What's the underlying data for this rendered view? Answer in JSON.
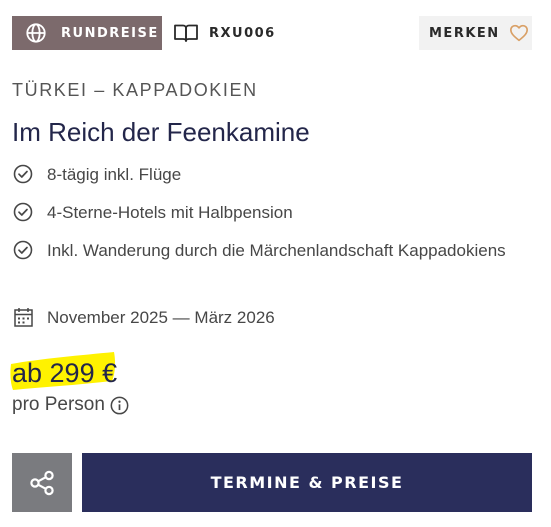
{
  "header": {
    "trip_type_label": "RUNDREISE",
    "trip_type_icon": "globe-icon",
    "trip_code": "RXU006",
    "trip_code_icon": "open-book-icon",
    "bookmark_label": "MERKEN",
    "bookmark_icon": "heart-outline-icon"
  },
  "trip": {
    "region": "TÜRKEI – KAPPADOKIEN",
    "title": "Im Reich der Feenkamine",
    "features": [
      "8-tägig inkl. Flüge",
      "4-Sterne-Hotels mit Halbpension",
      "Inkl. Wanderung durch die Märchenlandschaft Kappadokiens"
    ],
    "feature_icon": "check-circle-icon",
    "dates": "November 2025 — März 2026",
    "dates_icon": "calendar-icon"
  },
  "pricing": {
    "price": "ab 299 €",
    "per_person": "pro Person",
    "info_icon": "info-icon"
  },
  "actions": {
    "share_icon": "share-icon",
    "cta_label": "TERMINE & PREISE"
  },
  "colors": {
    "trip_type_badge": "#7c6a6c",
    "heart": "#d9a066",
    "title": "#23264a",
    "price_highlight": "#fff200",
    "share_button": "#7a7b7f",
    "cta_button": "#2a2e5c"
  }
}
